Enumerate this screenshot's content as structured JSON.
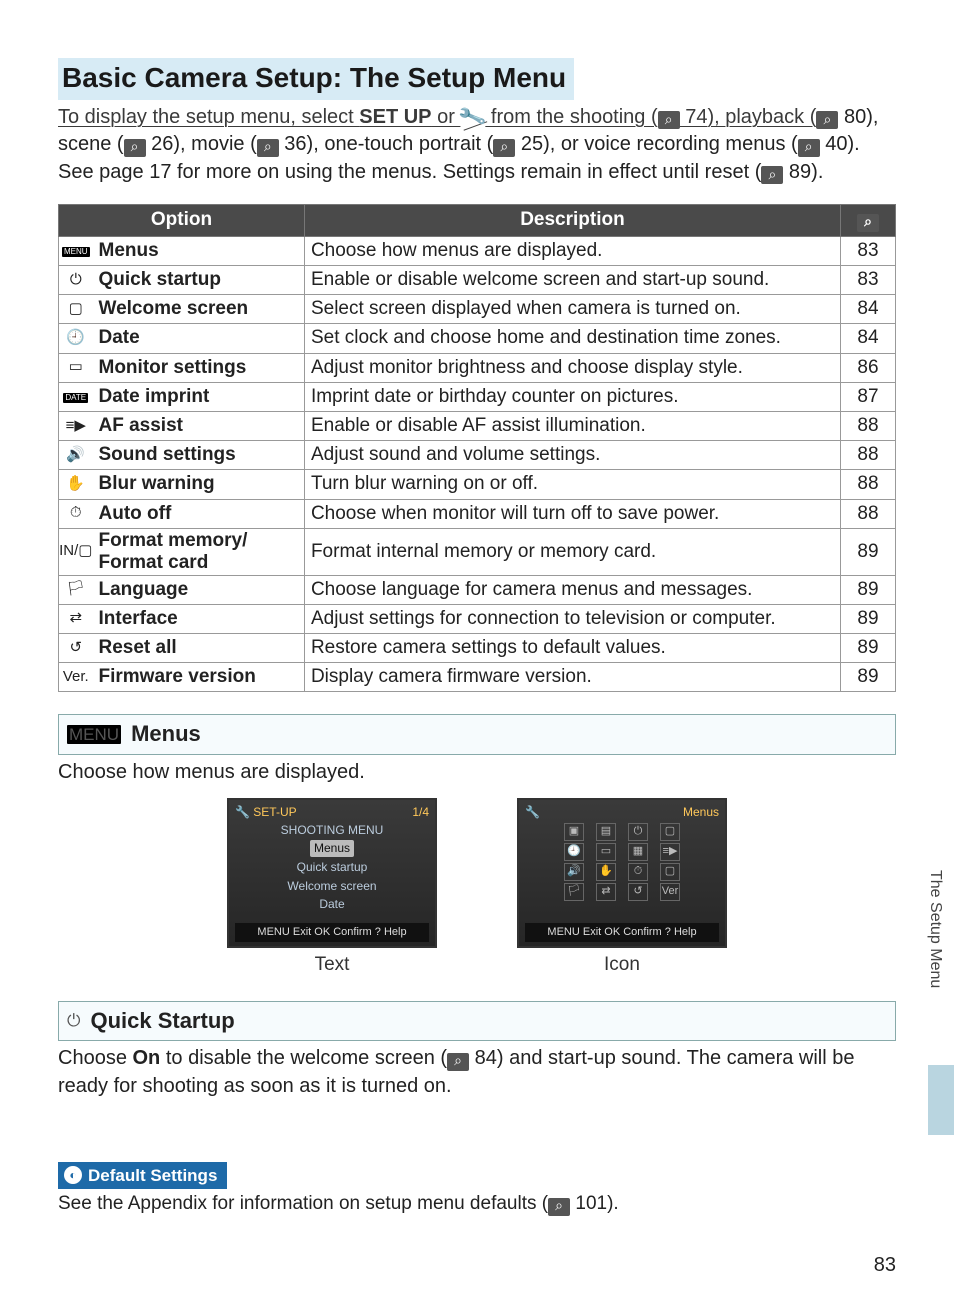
{
  "title": "Basic Camera Setup: The Setup Menu",
  "intro": {
    "pre": "To display the setup menu, select ",
    "setup": "SET UP",
    "or": " or ",
    "from": " from the shooting (",
    "p74": " 74), playback (",
    "p80": " 80), scene (",
    "p26": " 26), movie (",
    "p36": " 36), one-touch portrait (",
    "p25": " 25), or voice recording menus (",
    "p40": " 40).  See page 17 for more on using the menus.  Settings remain in effect until reset (",
    "p89": " 89)."
  },
  "table": {
    "headers": {
      "option": "Option",
      "description": "Description",
      "page": ""
    },
    "rows": [
      {
        "icon": "MENU",
        "chip": true,
        "name": "Menus",
        "desc": "Choose how menus are displayed.",
        "page": "83"
      },
      {
        "icon": "⏻",
        "name": "Quick startup",
        "desc": "Enable or disable welcome screen and start-up sound.",
        "page": "83"
      },
      {
        "icon": "▢",
        "name": "Welcome screen",
        "desc": "Select screen displayed when camera is turned on.",
        "page": "84"
      },
      {
        "icon": "🕘",
        "name": "Date",
        "desc": "Set clock and choose home and destination time zones.",
        "page": "84"
      },
      {
        "icon": "▭",
        "name": "Monitor settings",
        "desc": "Adjust monitor brightness and choose display style.",
        "page": "86"
      },
      {
        "icon": "DATE",
        "chip": true,
        "name": "Date imprint",
        "desc": "Imprint date or birthday counter on pictures.",
        "page": "87"
      },
      {
        "icon": "≡▶",
        "name": "AF assist",
        "desc": "Enable or disable AF assist illumination.",
        "page": "88"
      },
      {
        "icon": "🔊",
        "name": "Sound settings",
        "desc": "Adjust sound and volume settings.",
        "page": "88"
      },
      {
        "icon": "✋",
        "name": "Blur warning",
        "desc": "Turn blur warning on or off.",
        "page": "88"
      },
      {
        "icon": "⏱",
        "name": "Auto off",
        "desc": "Choose when monitor will turn off to save power.",
        "page": "88"
      },
      {
        "icon": "IN/▢",
        "name": "Format memory/\nFormat card",
        "desc": "Format internal memory or memory card.",
        "page": "89",
        "tall": true
      },
      {
        "icon": "🏳",
        "name": "Language",
        "desc": "Choose language for camera menus and messages.",
        "page": "89"
      },
      {
        "icon": "⇄",
        "name": "Interface",
        "desc": "Adjust settings for connection to television or computer.",
        "page": "89"
      },
      {
        "icon": "↺",
        "name": "Reset all",
        "desc": "Restore camera settings to default values.",
        "page": "89"
      },
      {
        "icon": "Ver.",
        "name": "Firmware version",
        "desc": "Display camera firmware version.",
        "page": "89"
      }
    ]
  },
  "menus": {
    "icon": "MENU",
    "heading": "Menus",
    "sub": "Choose how menus are displayed.",
    "caption_text": "Text",
    "caption_icon": "Icon",
    "lcd_text": {
      "hdr_left": "SET-UP",
      "hdr_right": "1/4",
      "l1": "SHOOTING MENU",
      "l2": "Menus",
      "l3": "Quick startup",
      "l4": "Welcome screen",
      "l5": "Date",
      "foot": "MENU Exit    OK Confirm  ? Help"
    },
    "lcd_icon": {
      "hdr_right": "Menus",
      "foot": "MENU Exit    OK Confirm  ? Help"
    }
  },
  "quick": {
    "icon": "⏻",
    "heading": "Quick Startup",
    "body1": "Choose ",
    "on": "On",
    "body2": " to disable the welcome screen (",
    "p84": " 84) and start-up sound.  The camera will be ready for shooting as soon as it is turned on."
  },
  "side_tab": "The Setup Menu",
  "info": {
    "heading": "Default Settings",
    "body1": "See the Appendix for information on setup menu defaults (",
    "p101": " 101)."
  },
  "pagenum": "83"
}
